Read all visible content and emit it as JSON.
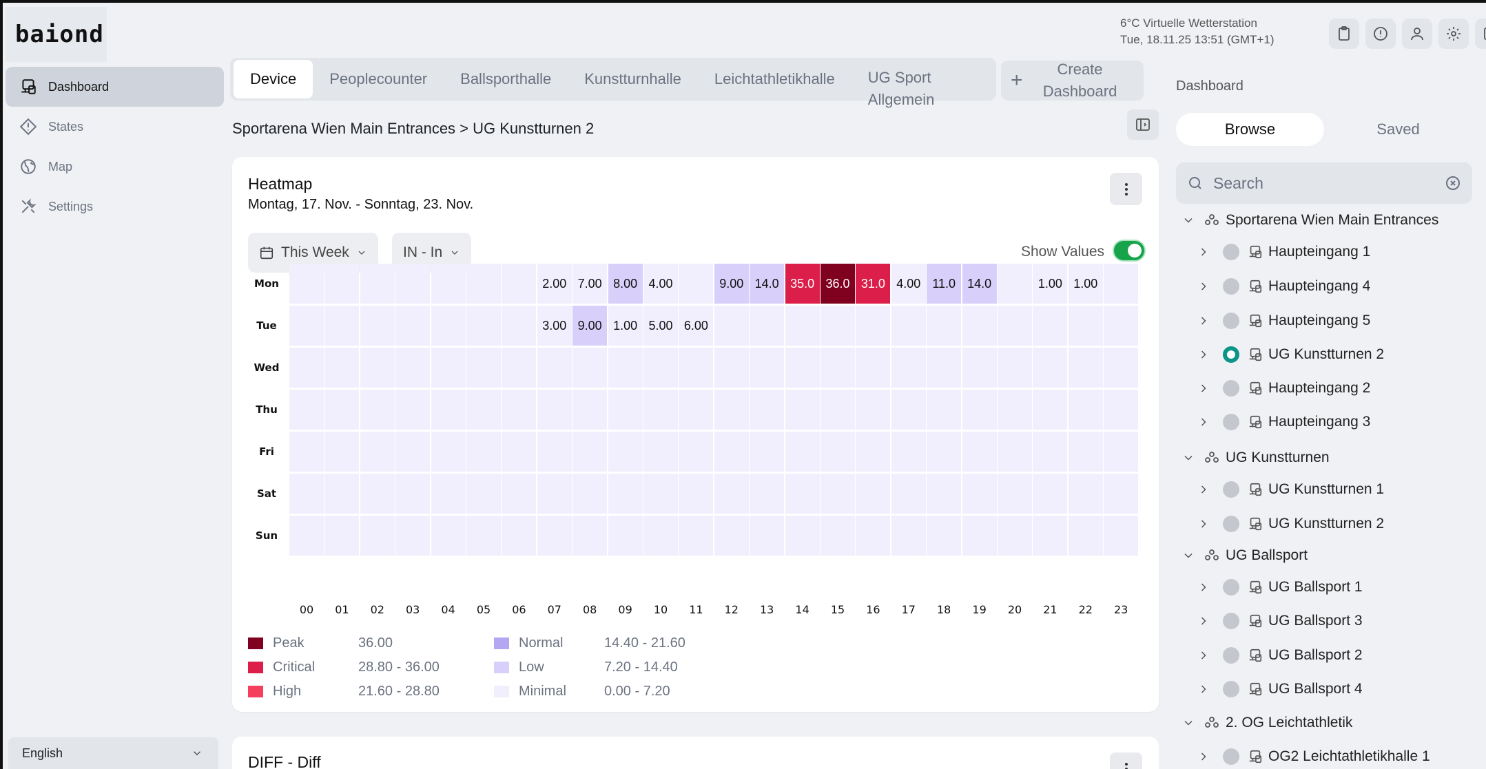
{
  "app": {
    "logo": "baiond"
  },
  "sidebar": {
    "items": [
      {
        "label": "Dashboard",
        "icon": "dashboard-icon",
        "active": true
      },
      {
        "label": "States",
        "icon": "states-icon",
        "active": false
      },
      {
        "label": "Map",
        "icon": "map-icon",
        "active": false
      },
      {
        "label": "Settings",
        "icon": "settings-icon",
        "active": false
      }
    ],
    "language": "English"
  },
  "header": {
    "weather": "6°C Virtuelle Wetterstation",
    "datetime": "Tue, 18.11.25 13:51 (GMT+1)",
    "icons": [
      "clipboard-icon",
      "alert-icon",
      "user-icon",
      "gear-icon",
      "logout-icon"
    ]
  },
  "tabs": {
    "items": [
      "Device",
      "Peoplecounter",
      "Ballsporthalle",
      "Kunstturnhalle",
      "Leichtathletikhalle",
      "UG Sport Allgemein"
    ],
    "active_index": 0,
    "create_label": "Create Dashboard"
  },
  "breadcrumb": "Sportarena Wien Main Entrances > UG Kunstturnen 2",
  "heatmap_card": {
    "title": "Heatmap",
    "subtitle": "Montag, 17. Nov. - Sonntag, 23. Nov.",
    "period_filter": "This Week",
    "direction_filter": "IN - In",
    "show_values_label": "Show Values",
    "show_values": true,
    "menu_icon": "kebab-icon"
  },
  "chart_data": {
    "type": "heatmap",
    "x": [
      "00",
      "01",
      "02",
      "03",
      "04",
      "05",
      "06",
      "07",
      "08",
      "09",
      "10",
      "11",
      "12",
      "13",
      "14",
      "15",
      "16",
      "17",
      "18",
      "19",
      "20",
      "21",
      "22",
      "23"
    ],
    "y": [
      "Mon",
      "Tue",
      "Wed",
      "Thu",
      "Fri",
      "Sat",
      "Sun"
    ],
    "values": [
      [
        null,
        null,
        null,
        null,
        null,
        null,
        null,
        2.0,
        7.0,
        8.0,
        4.0,
        null,
        9.0,
        14.0,
        35.0,
        36.0,
        31.0,
        4.0,
        11.0,
        14.0,
        null,
        1.0,
        1.0,
        null
      ],
      [
        null,
        null,
        null,
        null,
        null,
        null,
        null,
        3.0,
        9.0,
        1.0,
        5.0,
        6.0,
        null,
        null,
        null,
        null,
        null,
        null,
        null,
        null,
        null,
        null,
        null,
        null
      ],
      [
        null,
        null,
        null,
        null,
        null,
        null,
        null,
        null,
        null,
        null,
        null,
        null,
        null,
        null,
        null,
        null,
        null,
        null,
        null,
        null,
        null,
        null,
        null,
        null
      ],
      [
        null,
        null,
        null,
        null,
        null,
        null,
        null,
        null,
        null,
        null,
        null,
        null,
        null,
        null,
        null,
        null,
        null,
        null,
        null,
        null,
        null,
        null,
        null,
        null
      ],
      [
        null,
        null,
        null,
        null,
        null,
        null,
        null,
        null,
        null,
        null,
        null,
        null,
        null,
        null,
        null,
        null,
        null,
        null,
        null,
        null,
        null,
        null,
        null,
        null
      ],
      [
        null,
        null,
        null,
        null,
        null,
        null,
        null,
        null,
        null,
        null,
        null,
        null,
        null,
        null,
        null,
        null,
        null,
        null,
        null,
        null,
        null,
        null,
        null,
        null
      ],
      [
        null,
        null,
        null,
        null,
        null,
        null,
        null,
        null,
        null,
        null,
        null,
        null,
        null,
        null,
        null,
        null,
        null,
        null,
        null,
        null,
        null,
        null,
        null,
        null
      ]
    ],
    "labels": [
      [
        "",
        "",
        "",
        "",
        "",
        "",
        "",
        "2.00",
        "7.00",
        "8.00",
        "4.00",
        "",
        "9.00",
        "14.0",
        "35.0",
        "36.0",
        "31.0",
        "4.00",
        "11.0",
        "14.0",
        "",
        "1.00",
        "1.00",
        ""
      ],
      [
        "",
        "",
        "",
        "",
        "",
        "",
        "",
        "3.00",
        "9.00",
        "1.00",
        "5.00",
        "6.00",
        "",
        "",
        "",
        "",
        "",
        "",
        "",
        "",
        "",
        "",
        "",
        ""
      ]
    ],
    "legend": [
      {
        "name": "Peak",
        "range": "36.00",
        "color": "#800020",
        "min": 36
      },
      {
        "name": "Critical",
        "range": "28.80 - 36.00",
        "color": "#dc1f4a",
        "min": 28.8
      },
      {
        "name": "High",
        "range": "21.60 - 28.80",
        "color": "#f43f5e",
        "min": 21.6
      },
      {
        "name": "Normal",
        "range": "14.40 - 21.60",
        "color": "#b4a6f3",
        "min": 14.4
      },
      {
        "name": "Low",
        "range": "7.20 - 14.40",
        "color": "#d8d0fa",
        "min": 7.2
      },
      {
        "name": "Minimal",
        "range": "0.00 - 7.20",
        "color": "#f1effd",
        "min": 0
      }
    ]
  },
  "diff_card": {
    "title": "DIFF - Diff"
  },
  "right_panel": {
    "title": "Dashboard",
    "segments": [
      "Browse",
      "Saved"
    ],
    "active_segment": 0,
    "search_placeholder": "Search",
    "tree": [
      {
        "type": "group",
        "label": "Sportarena Wien Main Entrances"
      },
      {
        "type": "device",
        "label": "Haupteingang 1",
        "selected": false
      },
      {
        "type": "device",
        "label": "Haupteingang 4",
        "selected": false
      },
      {
        "type": "device",
        "label": "Haupteingang 5",
        "selected": false
      },
      {
        "type": "device",
        "label": "UG Kunstturnen 2",
        "selected": true
      },
      {
        "type": "device",
        "label": "Haupteingang 2",
        "selected": false
      },
      {
        "type": "device",
        "label": "Haupteingang 3",
        "selected": false
      },
      {
        "type": "group",
        "label": "UG Kunstturnen"
      },
      {
        "type": "device",
        "label": "UG Kunstturnen 1",
        "selected": false
      },
      {
        "type": "device",
        "label": "UG Kunstturnen 2",
        "selected": false
      },
      {
        "type": "group",
        "label": "UG Ballsport"
      },
      {
        "type": "device",
        "label": "UG Ballsport 1",
        "selected": false
      },
      {
        "type": "device",
        "label": "UG Ballsport 3",
        "selected": false
      },
      {
        "type": "device",
        "label": "UG Ballsport 2",
        "selected": false
      },
      {
        "type": "device",
        "label": "UG Ballsport 4",
        "selected": false
      },
      {
        "type": "group",
        "label": "2. OG Leichtathletik"
      },
      {
        "type": "device",
        "label": "OG2 Leichtathletikhalle 1",
        "selected": false
      }
    ]
  }
}
